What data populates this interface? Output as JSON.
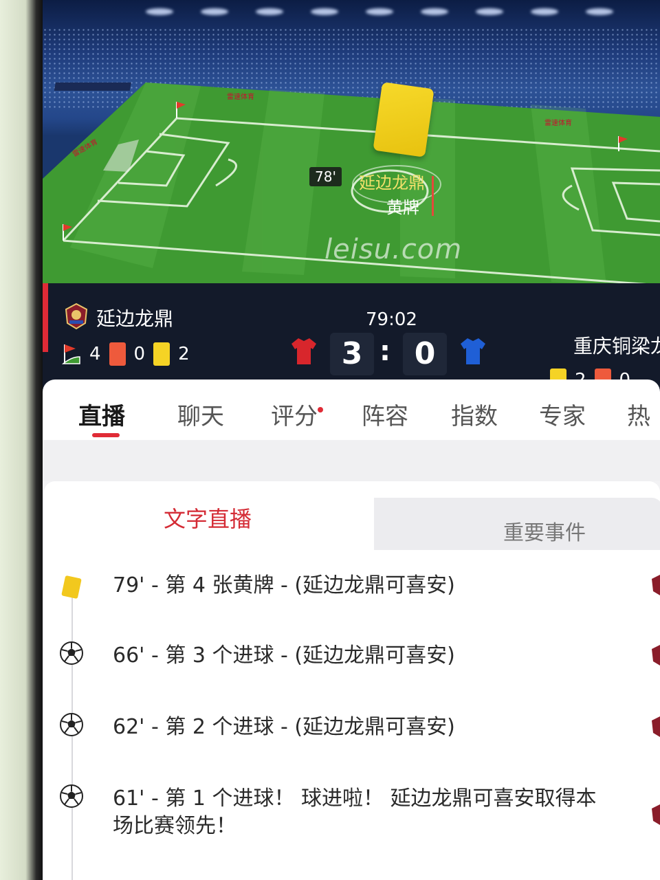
{
  "pitch": {
    "event_time": "78'",
    "event_player": "延边龙鼎",
    "event_type": "黄牌",
    "watermark": "leisu.com",
    "ad_text": "雷速体育"
  },
  "match": {
    "home_team": "延边龙鼎",
    "away_team": "重庆铜梁龙",
    "clock": "79:02",
    "home_score": "3",
    "away_score": "0",
    "home_stats": {
      "corners": "4",
      "red_cards": "0",
      "yellow_cards": "2"
    },
    "away_stats": {
      "yellow_cards": "2",
      "red_cards": "0"
    },
    "colors": {
      "home_jersey": "#d8262c",
      "away_jersey": "#1f5fd6"
    }
  },
  "tabs": [
    {
      "label": "直播"
    },
    {
      "label": "聊天"
    },
    {
      "label": "评分"
    },
    {
      "label": "阵容"
    },
    {
      "label": "指数"
    },
    {
      "label": "专家"
    },
    {
      "label": "热"
    }
  ],
  "live": {
    "subtabs": {
      "text_live": "文字直播",
      "key_events": "重要事件"
    },
    "events": [
      {
        "icon": "yellow-card-icon",
        "text": "79' - 第 4 张黄牌 - (延边龙鼎可喜安)"
      },
      {
        "icon": "soccer-ball-icon",
        "text": "66' - 第 3 个进球 - (延边龙鼎可喜安)"
      },
      {
        "icon": "soccer-ball-icon",
        "text": "62' - 第 2 个进球 - (延边龙鼎可喜安)"
      },
      {
        "icon": "soccer-ball-icon",
        "text": "61' - 第 1 个进球！ 球进啦！ 延边龙鼎可喜安取得本场比赛领先！"
      }
    ]
  }
}
